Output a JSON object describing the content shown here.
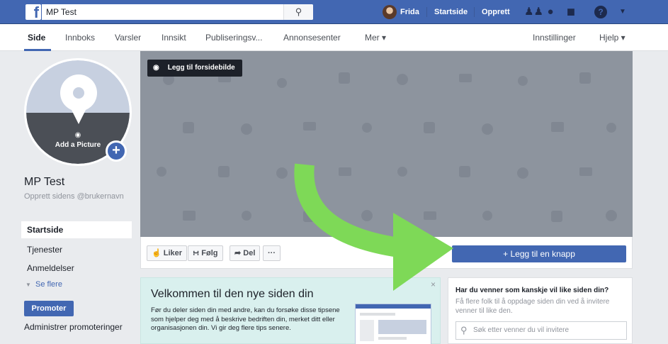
{
  "topbar": {
    "search_value": "MP Test",
    "user_name": "Frida",
    "links": [
      "Startside",
      "Opprett"
    ]
  },
  "pagenav": {
    "items": [
      "Side",
      "Innboks",
      "Varsler",
      "Innsikt",
      "Publiseringsv...",
      "Annonsesenter",
      "Mer ▾"
    ],
    "right_items": [
      "Innstillinger",
      "Hjelp ▾"
    ]
  },
  "profile": {
    "add_picture_label": "Add a Picture",
    "page_name": "MP Test",
    "username_prompt": "Opprett sidens @brukernavn"
  },
  "left_menu": {
    "items": [
      "Startside",
      "Tjenester",
      "Anmeldelser"
    ],
    "see_more": "Se flere",
    "promote_button": "Promoter",
    "manage_promotions": "Administrer promoteringer"
  },
  "cover": {
    "add_cover_label": "Legg til forsidebilde"
  },
  "actions": {
    "like": "Liker",
    "follow": "Følg",
    "share": "Del",
    "more": "···",
    "add_button": "+ Legg til en knapp"
  },
  "welcome": {
    "title": "Velkommen til den nye siden din",
    "text": "Før du deler siden din med andre, kan du forsøke disse tipsene som hjelper deg med å beskrive bedriften din, merket ditt eller organisasjonen din. Vi gir deg flere tips senere.",
    "close": "×"
  },
  "invite": {
    "title": "Har du venner som kanskje vil like siden din?",
    "text": "Få flere folk til å oppdage siden din ved å invitere venner til like den.",
    "placeholder": "Søk etter venner du vil invitere"
  },
  "colors": {
    "brand_blue": "#4267b2",
    "arrow_green": "#7ed957",
    "welcome_bg": "#d9f0ee"
  }
}
